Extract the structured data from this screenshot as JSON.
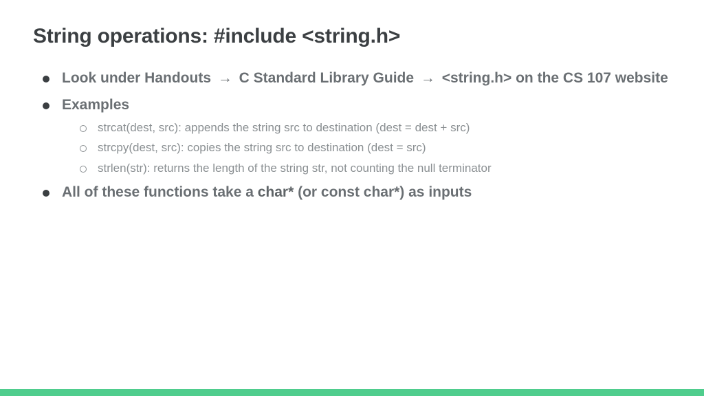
{
  "title": "String operations: #include <string.h>",
  "bullets": {
    "b1_pre": "Look under Handouts ",
    "b1_mid1": " C Standard Library Guide ",
    "b1_post": " <string.h> on the CS 107 website",
    "arrow": "→",
    "b2": "Examples",
    "sub1": "strcat(dest, src): appends the string src to destination (dest = dest + src)",
    "sub2": "strcpy(dest, src): copies the string src to destination (dest = src)",
    "sub3": "strlen(str): returns the length of the string str, not counting the null terminator",
    "b3_pre": "All of these functions take a ",
    "b3_bold": "char*",
    "b3_post": " (or const char*) as inputs"
  }
}
